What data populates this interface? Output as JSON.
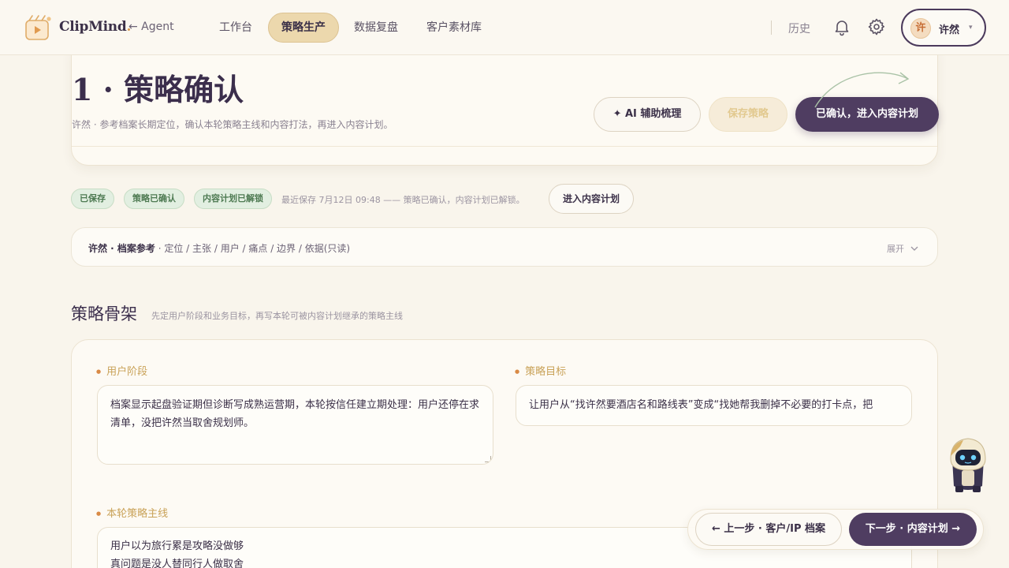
{
  "app": {
    "brand": "ClipMind",
    "brand_dot": ".",
    "agent_link": "← Agent"
  },
  "nav": {
    "items": [
      "工作台",
      "策略生产",
      "数据复盘",
      "客户素材库"
    ],
    "active_index": 1,
    "history": "历史",
    "user": {
      "avatar_char": "许",
      "name": "许然"
    }
  },
  "header": {
    "title": "1 · 策略确认",
    "subtitle": "许然 · 参考档案长期定位，确认本轮策略主线和内容打法，再进入内容计划。",
    "ai_button": "AI 辅助梳理",
    "ai_icon": "sparkle-icon",
    "save_button": "保存策略",
    "confirm_button": "已确认，进入内容计划"
  },
  "status": {
    "badges": [
      "已保存",
      "策略已确认",
      "内容计划已解锁"
    ],
    "text": "最近保存 7月12日 09:48 —— 策略已确认，内容计划已解锁。",
    "enter_plan_button": "进入内容计划"
  },
  "archive": {
    "title": "许然 · 档案参考",
    "fields": " · 定位 / 主张 / 用户 / 痛点 / 边界 / 依据(只读)",
    "expand": "展开"
  },
  "section": {
    "title": "策略骨架",
    "subtitle": "先定用户阶段和业务目标，再写本轮可被内容计划继承的策略主线"
  },
  "fields": {
    "user_stage": {
      "label": "用户阶段",
      "value": "档案显示起盘验证期但诊断写成熟运营期，本轮按信任建立期处理：用户还停在求清单，没把许然当取舍规划师。"
    },
    "strategy_goal": {
      "label": "策略目标",
      "value": "让用户从“找许然要酒店名和路线表”变成“找她帮我删掉不必要的打卡点，把"
    },
    "main_line": {
      "label": "本轮策略主线",
      "value_lines": [
        "用户以为旅行累是攻略没做够",
        "真问题是没人替同行人做取舍"
      ]
    }
  },
  "bottom": {
    "prev_button": "← 上一步 · 客户/IP 档案",
    "next_button": "下一步 · 内容计划 →"
  },
  "colors": {
    "primary": "#4f3d61",
    "accent_gold": "#ecd8ad",
    "badge_green": "#e2efe1",
    "label_gold": "#c9a258"
  }
}
